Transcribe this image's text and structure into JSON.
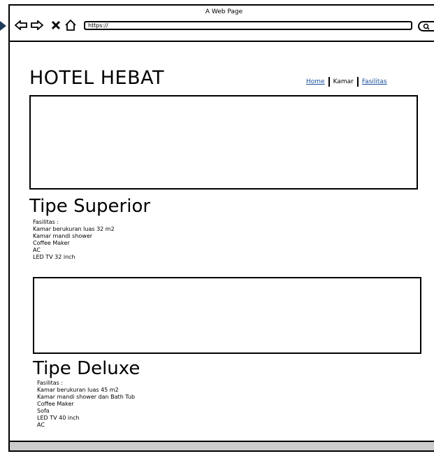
{
  "browser": {
    "window_title": "A Web Page",
    "url": "https://"
  },
  "site": {
    "title": "HOTEL HEBAT",
    "nav": [
      "Home",
      "Kamar",
      "Fasilitas"
    ]
  },
  "rooms": [
    {
      "name": "Tipe Superior",
      "facilities_label": "Fasilitas :",
      "facilities": [
        "Kamar berukuran luas 32 m2",
        "Kamar mandi shower",
        "Coffee Maker",
        "AC",
        "LED TV 32 inch"
      ]
    },
    {
      "name": "Tipe Deluxe",
      "facilities_label": "Fasilitas :",
      "facilities": [
        "Kamar berukuran luas 45 m2",
        "Kamar mandi shower dan Bath Tub",
        "Coffee Maker",
        "Sofa",
        "LED TV 40 inch",
        "AC"
      ]
    }
  ]
}
